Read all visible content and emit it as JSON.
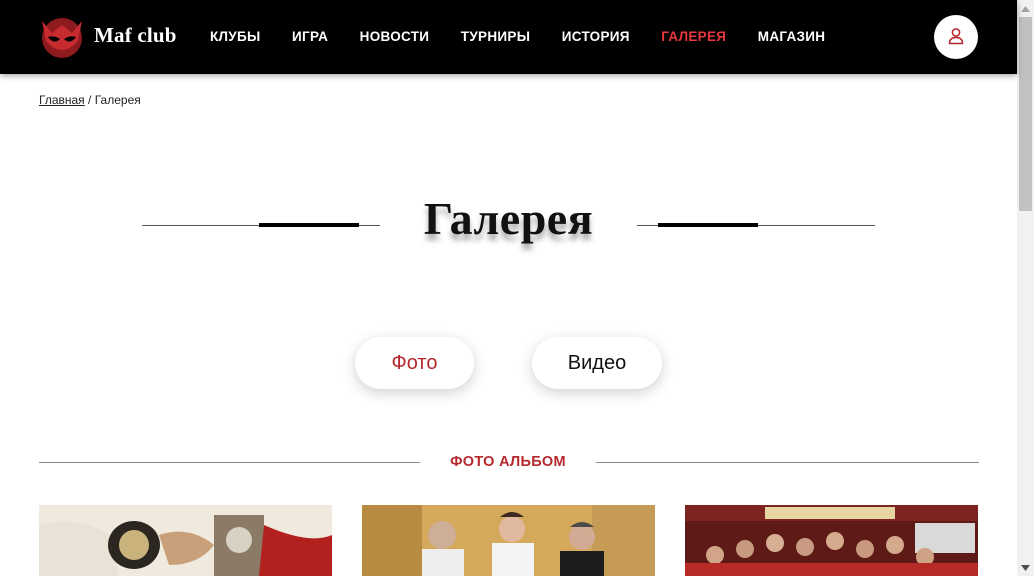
{
  "header": {
    "brand": "Maf club",
    "logo_icon": "mask-logo-icon",
    "nav": [
      {
        "label": "КЛУБЫ",
        "active": false
      },
      {
        "label": "ИГРА",
        "active": false
      },
      {
        "label": "НОВОСТИ",
        "active": false
      },
      {
        "label": "ТУРНИРЫ",
        "active": false
      },
      {
        "label": "ИСТОРИЯ",
        "active": false
      },
      {
        "label": "ГАЛЕРЕЯ",
        "active": true
      },
      {
        "label": "МАГАЗИН",
        "active": false
      }
    ],
    "user_icon": "user-icon"
  },
  "breadcrumb": {
    "home": "Главная",
    "separator": "/",
    "current": "Галерея"
  },
  "page": {
    "title": "Галерея"
  },
  "tabs": [
    {
      "label": "Фото",
      "active": true
    },
    {
      "label": "Видео",
      "active": false
    }
  ],
  "section": {
    "title": "ФОТО АЛЬБОМ"
  },
  "albums": [
    {
      "subject": "hands-with-watches"
    },
    {
      "subject": "group-photo-three-men"
    },
    {
      "subject": "group-photo-crowd"
    }
  ],
  "colors": {
    "accent": "#e8383d",
    "accent_dark": "#b5282d",
    "header_bg": "#000000"
  }
}
